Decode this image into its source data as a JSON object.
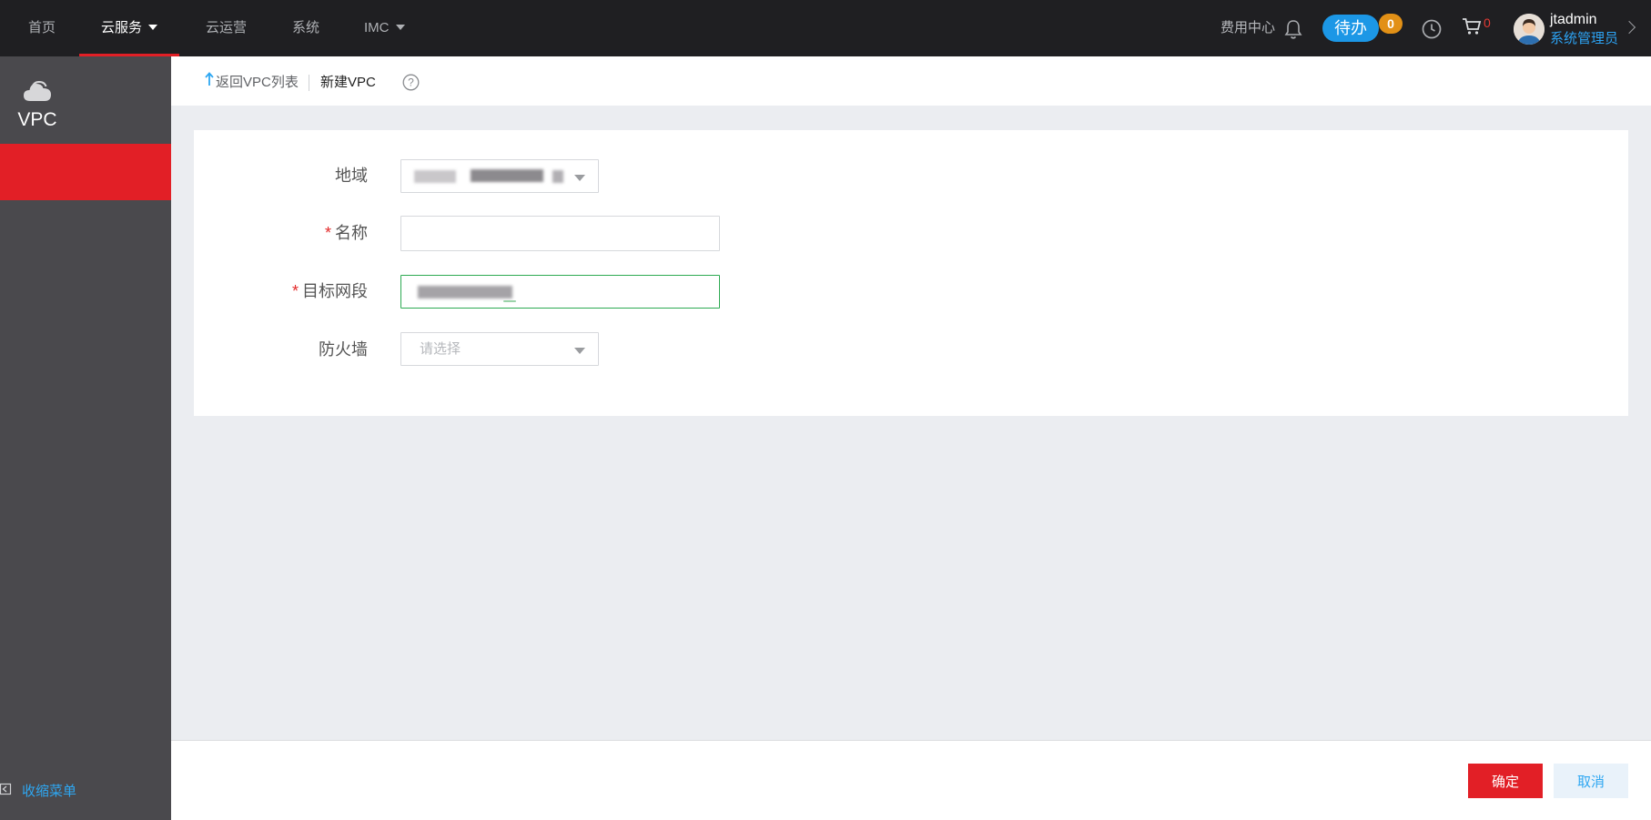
{
  "topbar": {
    "nav": [
      {
        "label": "首页"
      },
      {
        "label": "云服务"
      },
      {
        "label": "云运营"
      },
      {
        "label": "系统"
      },
      {
        "label": "IMC"
      }
    ],
    "billing_center": "费用中心",
    "todo_label": "待办",
    "todo_count": "0",
    "cart_count": "0",
    "user": {
      "name": "jtadmin",
      "role": "系统管理员"
    }
  },
  "sidebar": {
    "title": "VPC",
    "collapse_label": "收缩菜单"
  },
  "header": {
    "back_label": "返回VPC列表",
    "page_title": "新建VPC"
  },
  "form": {
    "region_label": "地域",
    "name_label": "名称",
    "cidr_label": "目标网段",
    "firewall_label": "防火墙",
    "required_mark": "*",
    "name_value": "",
    "firewall_placeholder": "请选择"
  },
  "footer": {
    "confirm_label": "确定",
    "cancel_label": "取消"
  },
  "colors": {
    "accent_red": "#e21f26",
    "link_blue": "#2ea7f2",
    "todo_blue": "#1c97e6",
    "badge_orange": "#e29016",
    "focus_green": "#2daa52"
  }
}
